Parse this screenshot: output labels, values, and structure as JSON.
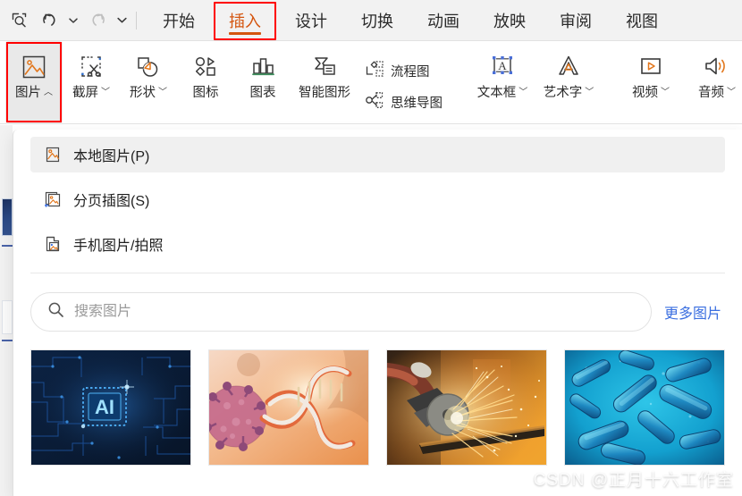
{
  "quick_access": {
    "items": [
      {
        "name": "find-icon",
        "label": "查找",
        "glyph": "search"
      },
      {
        "name": "undo-icon",
        "label": "撤销",
        "glyph": "undo"
      },
      {
        "name": "undo-dropdown",
        "label": "撤销选项",
        "glyph": "caret"
      },
      {
        "name": "redo-icon",
        "label": "恢复",
        "glyph": "redo"
      },
      {
        "name": "qat-more",
        "label": "自定义快速访问工具栏",
        "glyph": "caret"
      }
    ]
  },
  "tabs": [
    {
      "label": "开始",
      "active": false
    },
    {
      "label": "插入",
      "active": true
    },
    {
      "label": "设计",
      "active": false
    },
    {
      "label": "切换",
      "active": false
    },
    {
      "label": "动画",
      "active": false
    },
    {
      "label": "放映",
      "active": false
    },
    {
      "label": "审阅",
      "active": false
    },
    {
      "label": "视图",
      "active": false
    }
  ],
  "ribbon": {
    "group1": [
      {
        "label": "图片",
        "icon": "picture-icon",
        "caret": "︿",
        "selected": true,
        "highlighted": true
      },
      {
        "label": "截屏",
        "icon": "screenshot-icon",
        "caret": "﹀",
        "selected": false,
        "highlighted": false
      },
      {
        "label": "形状",
        "icon": "shapes-icon",
        "caret": "﹀",
        "selected": false,
        "highlighted": false
      },
      {
        "label": "图标",
        "icon": "icons-icon",
        "caret": "",
        "selected": false,
        "highlighted": false
      },
      {
        "label": "图表",
        "icon": "chart-icon",
        "caret": "",
        "selected": false,
        "highlighted": false
      },
      {
        "label": "智能图形",
        "icon": "smartart-icon",
        "caret": "",
        "selected": false,
        "highlighted": false
      }
    ],
    "group1_stack": [
      {
        "label": "流程图",
        "icon": "flowchart-icon"
      },
      {
        "label": "思维导图",
        "icon": "mindmap-icon"
      }
    ],
    "group2": [
      {
        "label": "文本框",
        "icon": "textbox-icon",
        "caret": "﹀"
      },
      {
        "label": "艺术字",
        "icon": "wordart-icon",
        "caret": "﹀"
      }
    ],
    "group3": [
      {
        "label": "视频",
        "icon": "video-icon",
        "caret": "﹀"
      },
      {
        "label": "音频",
        "icon": "audio-icon",
        "caret": "﹀"
      }
    ]
  },
  "dropdown": {
    "menu_items": [
      {
        "label": "本地图片(P)",
        "icon": "local-picture-icon",
        "active": true
      },
      {
        "label": "分页插图(S)",
        "icon": "paged-picture-icon",
        "active": false
      },
      {
        "label": "手机图片/拍照",
        "icon": "phone-picture-icon",
        "active": false
      }
    ],
    "search": {
      "placeholder": "搜索图片",
      "value": "",
      "icon": "search-icon"
    },
    "more_link": "更多图片",
    "thumbnails": [
      {
        "name": "thumbnail-ai-circuit",
        "caption": "AI 芯片电路",
        "badge": "AI"
      },
      {
        "name": "thumbnail-dna-virus",
        "caption": "DNA 与病毒",
        "badge": ""
      },
      {
        "name": "thumbnail-grinding-sparks",
        "caption": "切割火花",
        "badge": ""
      },
      {
        "name": "thumbnail-bacteria",
        "caption": "细菌",
        "badge": ""
      }
    ]
  },
  "watermark": "CSDN @正月十六工作室",
  "colors": {
    "accent": "#d4550f",
    "highlight_box": "#ff0000",
    "link": "#3b6fe0",
    "ribbon_bg": "#ffffff",
    "topbar_bg": "#f2f2f2"
  }
}
